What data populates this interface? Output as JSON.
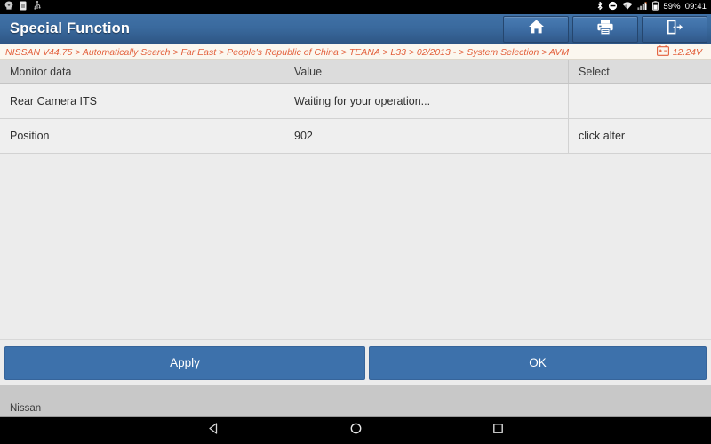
{
  "statusbar": {
    "left_icons": [
      "notification-icon",
      "sim-card-icon",
      "usb-icon"
    ],
    "right_icons": [
      "bluetooth-icon",
      "do-not-disturb-icon",
      "wifi-icon",
      "signal-icon",
      "battery-icon"
    ],
    "battery_percent": "59%",
    "time": "09:41"
  },
  "titlebar": {
    "title": "Special Function",
    "buttons": [
      {
        "name": "home-button",
        "icon": "home-icon"
      },
      {
        "name": "print-button",
        "icon": "printer-icon"
      },
      {
        "name": "exit-button",
        "icon": "exit-icon"
      }
    ],
    "bg_gradient_top": "#4071a6",
    "bg_gradient_bottom": "#2e5685"
  },
  "breadcrumb": {
    "path": "NISSAN V44.75 > Automatically Search > Far East > People's Republic of China > TEANA > L33 > 02/2013 - > System Selection > AVM",
    "voltage": "12.24V",
    "voltage_icon": "car-battery-icon",
    "text_color": "#e3603c",
    "bg_color": "#fbf7ef"
  },
  "table": {
    "headers": [
      "Monitor data",
      "Value",
      "Select"
    ],
    "rows": [
      {
        "monitor_data": "Rear Camera ITS",
        "value": "Waiting for your operation...",
        "select": ""
      },
      {
        "monitor_data": "Position",
        "value": "902",
        "select": "click alter"
      }
    ]
  },
  "actions": {
    "apply_label": "Apply",
    "ok_label": "OK",
    "button_color": "#3d71ab"
  },
  "footer": {
    "label": "Nissan"
  },
  "navbar": {
    "buttons": [
      {
        "name": "android-back-button",
        "icon": "triangle-back-icon"
      },
      {
        "name": "android-home-button",
        "icon": "circle-home-icon"
      },
      {
        "name": "android-recents-button",
        "icon": "square-recents-icon"
      }
    ]
  }
}
